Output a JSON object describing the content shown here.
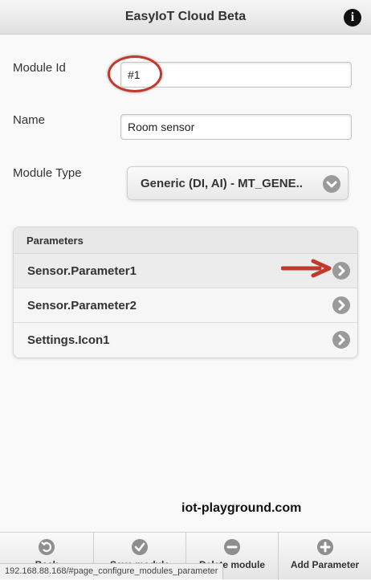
{
  "header": {
    "title": "EasyIoT Cloud Beta",
    "info_icon": "info-icon"
  },
  "form": {
    "module_id_label": "Module Id",
    "module_id_value": "#1",
    "name_label": "Name",
    "name_value": "Room sensor",
    "module_type_label": "Module Type",
    "module_type_value": "Generic (DI, AI) - MT_GENE.."
  },
  "parameters": {
    "heading": "Parameters",
    "items": [
      {
        "label": "Sensor.Parameter1"
      },
      {
        "label": "Sensor.Parameter2"
      },
      {
        "label": "Settings.Icon1"
      }
    ]
  },
  "watermark": "iot-playground.com",
  "footer": {
    "buttons": [
      {
        "label": "Back",
        "icon": "back-arrow-icon"
      },
      {
        "label": "Save module",
        "icon": "check-icon"
      },
      {
        "label": "Delete module",
        "icon": "minus-icon"
      },
      {
        "label": "Add Parameter",
        "icon": "plus-icon"
      }
    ]
  },
  "status_bar": "192.168.88.168/#page_configure_modules_parameter",
  "colors": {
    "highlight_red": "#c0392b",
    "icon_gray": "#9a9a9a"
  }
}
